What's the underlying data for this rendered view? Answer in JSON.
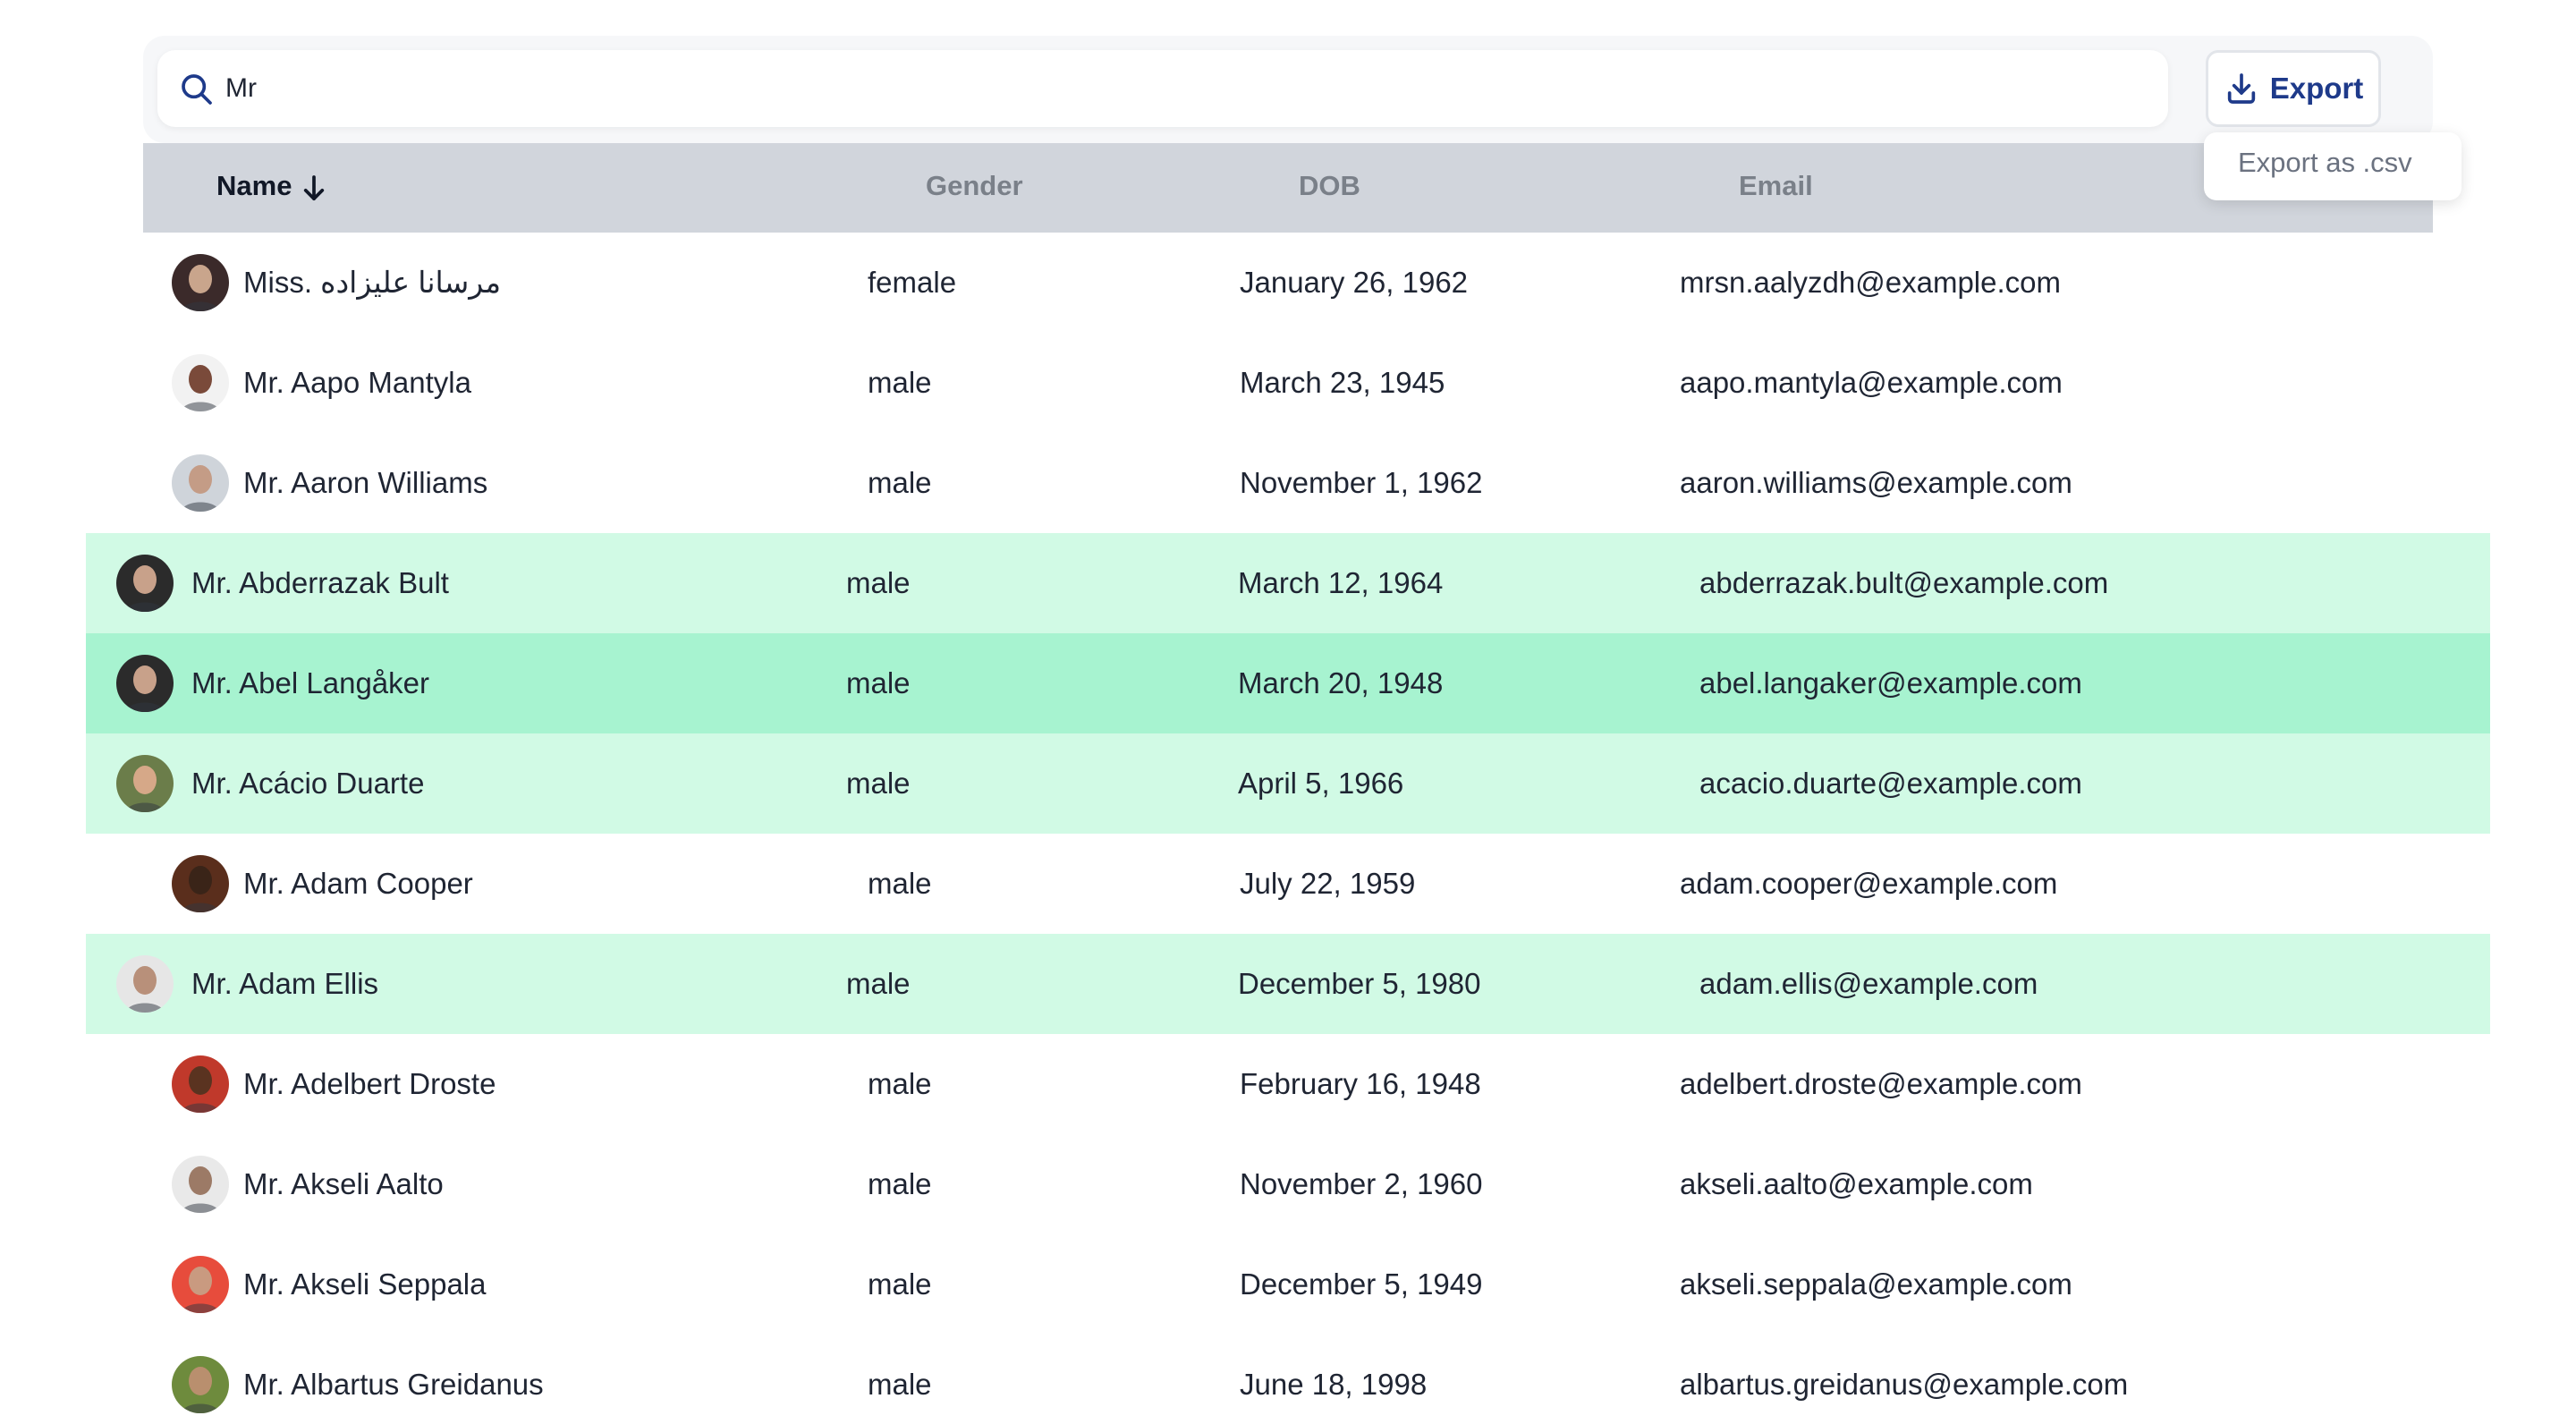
{
  "search": {
    "value": "Mr",
    "icon": "search-icon"
  },
  "export": {
    "label": "Export",
    "icon": "download-icon",
    "menu": [
      {
        "label": "Export as .csv"
      }
    ]
  },
  "table": {
    "columns": {
      "name": "Name",
      "gender": "Gender",
      "dob": "DOB",
      "email": "Email"
    },
    "sort": {
      "column": "name",
      "direction": "descending-arrow"
    },
    "colors": {
      "header_bg": "#d1d5dc",
      "highlight_light": "#d1fae5",
      "highlight_strong": "#a7f3d0",
      "accent": "#1e3a8a"
    },
    "rows": [
      {
        "name": "Miss. مرسانا علیزاده",
        "gender": "female",
        "dob": "January 26, 1962",
        "email": "mrsn.aalyzdh@example.com",
        "highlight": "none",
        "avatar_colors": [
          "#3b2a2a",
          "#c9a58c"
        ]
      },
      {
        "name": "Mr. Aapo Mantyla",
        "gender": "male",
        "dob": "March 23, 1945",
        "email": "aapo.mantyla@example.com",
        "highlight": "none",
        "avatar_colors": [
          "#f2f2f2",
          "#7a4a3a"
        ]
      },
      {
        "name": "Mr. Aaron Williams",
        "gender": "male",
        "dob": "November 1, 1962",
        "email": "aaron.williams@example.com",
        "highlight": "none",
        "avatar_colors": [
          "#cfd4da",
          "#c49c86"
        ]
      },
      {
        "name": "Mr. Abderrazak Bult",
        "gender": "male",
        "dob": "March 12, 1964",
        "email": "abderrazak.bult@example.com",
        "highlight": "light",
        "avatar_colors": [
          "#2b2b2b",
          "#c8a18a"
        ]
      },
      {
        "name": "Mr. Abel Langåker",
        "gender": "male",
        "dob": "March 20, 1948",
        "email": "abel.langaker@example.com",
        "highlight": "strong",
        "avatar_colors": [
          "#2b2b2b",
          "#c8a18a"
        ]
      },
      {
        "name": "Mr. Acácio Duarte",
        "gender": "male",
        "dob": "April 5, 1966",
        "email": "acacio.duarte@example.com",
        "highlight": "light",
        "avatar_colors": [
          "#6b7d4a",
          "#d6a888"
        ]
      },
      {
        "name": "Mr. Adam Cooper",
        "gender": "male",
        "dob": "July 22, 1959",
        "email": "adam.cooper@example.com",
        "highlight": "none",
        "avatar_colors": [
          "#5a2e1c",
          "#3a2418"
        ]
      },
      {
        "name": "Mr. Adam Ellis",
        "gender": "male",
        "dob": "December 5, 1980",
        "email": "adam.ellis@example.com",
        "highlight": "light",
        "avatar_colors": [
          "#e6e6e6",
          "#b8907a"
        ]
      },
      {
        "name": "Mr. Adelbert Droste",
        "gender": "male",
        "dob": "February 16, 1948",
        "email": "adelbert.droste@example.com",
        "highlight": "none",
        "avatar_colors": [
          "#c0392b",
          "#5a3320"
        ]
      },
      {
        "name": "Mr. Akseli Aalto",
        "gender": "male",
        "dob": "November 2, 1960",
        "email": "akseli.aalto@example.com",
        "highlight": "none",
        "avatar_colors": [
          "#e9e9e9",
          "#9c7a66"
        ]
      },
      {
        "name": "Mr. Akseli Seppala",
        "gender": "male",
        "dob": "December 5, 1949",
        "email": "akseli.seppala@example.com",
        "highlight": "none",
        "avatar_colors": [
          "#e74c3c",
          "#c99a80"
        ]
      },
      {
        "name": "Mr. Albartus Greidanus",
        "gender": "male",
        "dob": "June 18, 1998",
        "email": "albartus.greidanus@example.com",
        "highlight": "none",
        "avatar_colors": [
          "#6e8b3d",
          "#b98f6e"
        ]
      }
    ]
  }
}
